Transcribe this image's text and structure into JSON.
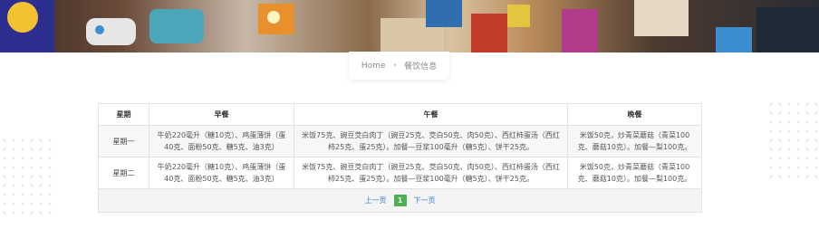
{
  "breadcrumb": {
    "home": "Home",
    "separator": "•",
    "current": "餐饮信息"
  },
  "table": {
    "headers": {
      "day": "星期",
      "breakfast": "早餐",
      "lunch": "午餐",
      "dinner": "晚餐"
    },
    "rows": [
      {
        "day": "星期一",
        "breakfast": "牛奶220毫升（糖10克）、鸡蛋薄饼（蛋40克、面粉50克、糖5克、油3克）",
        "lunch": "米饭75克、豌豆茭白肉丁（豌豆25克、茭白50克、肉50克）、西红柿蛋汤（西红柿25克、蛋25克）。加餐—豆浆100毫升（糖5克）、饼干25克。",
        "dinner": "米饭50克，炒青菜蘑菇（青菜100克、蘑菇10克）。加餐—梨100克。"
      },
      {
        "day": "星期二",
        "breakfast": "牛奶220毫升（糖10克）、鸡蛋薄饼（蛋40克、面粉50克、糖5克、油3克）",
        "lunch": "米饭75克、豌豆茭白肉丁（豌豆25克、茭白50克、肉50克）、西红柿蛋汤（西红柿25克、蛋25克）。加餐—豆浆100毫升（糖5克）、饼干25克。",
        "dinner": "米饭50克，炒青菜蘑菇（青菜100克、蘑菇10克）。加餐—梨100克。"
      }
    ]
  },
  "pagination": {
    "prev": "上一页",
    "current": "1",
    "next": "下一页"
  },
  "colors": {
    "accent_green": "#4caf50",
    "link_blue": "#3c7fc2"
  }
}
